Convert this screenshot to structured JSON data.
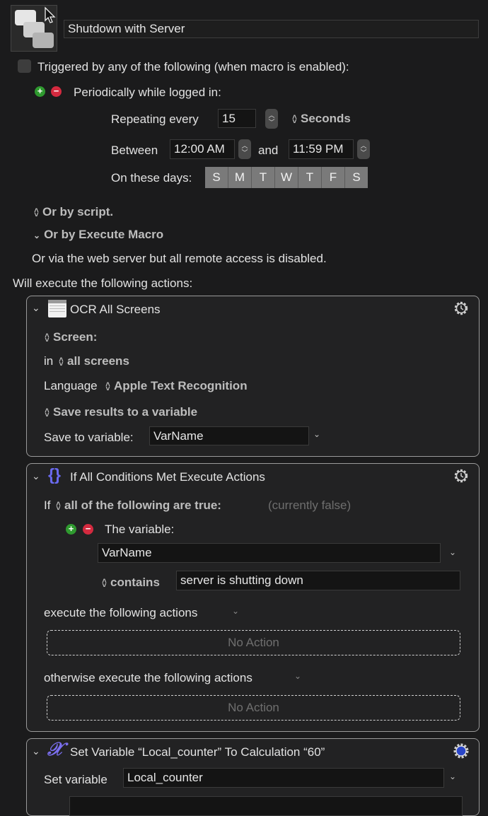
{
  "macro": {
    "name": "Shutdown with Server",
    "icon": "macro-group-icon"
  },
  "trigger": {
    "checkbox_label": "Triggered by any of the following (when macro is enabled):",
    "checked": false,
    "periodic": {
      "title": "Periodically while logged in:",
      "repeating_label": "Repeating every",
      "repeating_value": "15",
      "unit": "Seconds",
      "between_label": "Between",
      "start_time": "12:00 AM",
      "and_label": "and",
      "end_time": "11:59 PM",
      "days_label": "On these days:",
      "days": [
        "S",
        "M",
        "T",
        "W",
        "T",
        "F",
        "S"
      ]
    },
    "or_by_script": "Or by script.",
    "or_by_execute_macro": "Or by Execute Macro",
    "web_server_note": "Or via the web server but all remote access is disabled."
  },
  "actions_header": "Will execute the following actions:",
  "actions": {
    "ocr": {
      "title": "OCR All Screens",
      "screen_label": "Screen:",
      "in_label": "in",
      "in_value": "all screens",
      "language_label": "Language",
      "language_value": "Apple Text Recognition",
      "save_mode": "Save results to a variable",
      "save_label": "Save to variable:",
      "save_value": "VarName"
    },
    "if": {
      "title": "If All Conditions Met Execute Actions",
      "if_label": "If",
      "condition_mode": "all of the following are true:",
      "status": "(currently false)",
      "condition_type": "The variable:",
      "variable": "VarName",
      "operator": "contains",
      "operand": "server is shutting down",
      "then_label": "execute the following actions",
      "then_empty": "No Action",
      "else_label": "otherwise execute the following actions",
      "else_empty": "No Action"
    },
    "setvar": {
      "title": "Set Variable “Local_counter” To Calculation “60”",
      "set_label": "Set variable",
      "variable": "Local_counter"
    }
  },
  "colors": {
    "accent_blue": "#2a46c8",
    "plus_green": "#2f9a2f",
    "minus_red": "#d42a3f",
    "if_icon": "#6a6af0"
  }
}
